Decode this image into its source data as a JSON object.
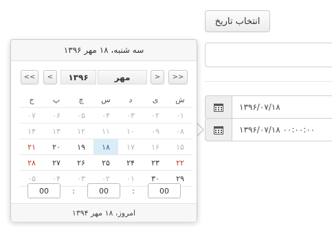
{
  "page": {
    "open_button_label": "انتخاب تاریخ",
    "field_date_value": "۱۳۹۶/۰۷/۱۸",
    "field_datetime_value": "۱۳۹۶/۰۷/۱۸  ۰۰:۰۰:۰۰"
  },
  "calendar": {
    "header_date": "سه شنبه، ۱۸ مهر ۱۳۹۶",
    "nav_prev_year": "<<",
    "nav_prev_month": "<",
    "nav_next_month": ">",
    "nav_next_year": ">>",
    "year_label": "۱۳۹۶",
    "month_label": "مهر",
    "weekdays": [
      "ش",
      "ی",
      "د",
      "س",
      "چ",
      "پ",
      "ج"
    ],
    "weeks": [
      [
        "۰۱",
        "۰۲",
        "۰۳",
        "۰۴",
        "۰۵",
        "۰۶",
        "۰۷"
      ],
      [
        "۰۸",
        "۰۹",
        "۱۰",
        "۱۱",
        "۱۲",
        "۱۳",
        "۱۴"
      ],
      [
        "۱۵",
        "۱۶",
        "۱۷",
        "۱۸",
        "۱۹",
        "۲۰",
        "۲۱"
      ],
      [
        "۲۲",
        "۲۳",
        "۲۴",
        "۲۵",
        "۲۶",
        "۲۷",
        "۲۸"
      ],
      [
        "۲۹",
        "۳۰",
        "۰۱",
        "۰۲",
        "۰۳",
        "۰۴",
        "۰۵"
      ]
    ],
    "time_hour": "00",
    "time_minute": "00",
    "time_second": "00",
    "time_separator": ":",
    "footer_today": "امروز، ۱۸ مهر ۱۳۹۴"
  }
}
